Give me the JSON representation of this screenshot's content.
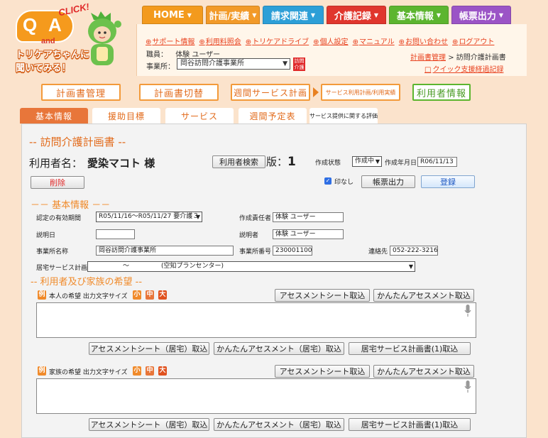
{
  "logo": {
    "qa_q": "Q",
    "qa_a": "A",
    "click": "CLICK!",
    "and": "and",
    "text": "トリケアちゃんに聞いてみる！"
  },
  "nav": [
    {
      "label": "HOME",
      "color": "#f39a1d"
    },
    {
      "label": "計画/実績",
      "color": "#f29a29"
    },
    {
      "label": "請求関連",
      "color": "#2d9fd7"
    },
    {
      "label": "介護記録",
      "color": "#e0362d"
    },
    {
      "label": "基本情報",
      "color": "#5cb52f"
    },
    {
      "label": "帳票出力",
      "color": "#9b54c6"
    }
  ],
  "links": [
    "サポート情報",
    "利用料照会",
    "トリケアドライブ",
    "個人設定",
    "マニュアル",
    "お問い合わせ",
    "ログアウト"
  ],
  "staff": {
    "label": "職員：",
    "value": "体験 ユーザー"
  },
  "office": {
    "label": "事業所：",
    "value": "岡谷訪問介護事業所",
    "badge": "訪問介護"
  },
  "breadcrumb": {
    "parent": "計画書管理",
    "sep": ">",
    "current": "訪問介護計画書"
  },
  "quick_link": "クイック支援経過記録",
  "big_tabs": [
    "計画書管理",
    "計画書切替",
    "週間サービス計画",
    "サービス利用計画/利用実績",
    "利用者情報"
  ],
  "sub_tabs": [
    "基本情報",
    "援助目標",
    "サービス",
    "週間予定表",
    "サービス提供に関する評価"
  ],
  "form": {
    "title": "-- 訪問介護計画書 --",
    "user_label": "利用者名：",
    "user_name": "愛染マコト 様",
    "search_button": "利用者検索",
    "version_label": "版：",
    "version": "1",
    "status_label": "作成状態",
    "status_value": "作成中",
    "date_label": "作成年月日",
    "date_value": "R06/11/13",
    "delete_button": "削除",
    "stamp_label": "印なし",
    "print_button": "帳票出力",
    "register_button": "登録"
  },
  "basic": {
    "section_title": "－－ 基本情報 －－",
    "validity_label": "認定の有効期間",
    "validity_value": "R05/11/16～R05/11/27 要介護３",
    "creator_label": "作成責任者",
    "creator_value": "体験 ユーザー",
    "explain_date_label": "説明日",
    "explain_date_value": "",
    "explainer_label": "説明者",
    "explainer_value": "体験 ユーザー",
    "office_name_label": "事業所名称",
    "office_name_value": "岡谷訪問介護事業所",
    "office_no_label": "事業所番号",
    "office_no_value": "2300011002",
    "contact_label": "連絡先",
    "contact_value": "052-222-3216",
    "care_plan_label": "居宅サービス計画者",
    "care_plan_value": "～　　　　　(空知プランセンター)"
  },
  "wishes": {
    "section_title": "-- 利用者及び家族の希望 --",
    "example": "例",
    "self_label": "本人の希望 出力文字サイズ",
    "family_label": "家族の希望 出力文字サイズ",
    "sizes": [
      "小",
      "中",
      "大"
    ],
    "assess_button": "アセスメントシート取込",
    "easy_assess_button": "かんたんアセスメント取込",
    "assess_home_button": "アセスメントシート（居宅）取込",
    "easy_assess_home_button": "かんたんアセスメント（居宅）取込",
    "care_plan1_button": "居宅サービス計画書(1)取込"
  }
}
